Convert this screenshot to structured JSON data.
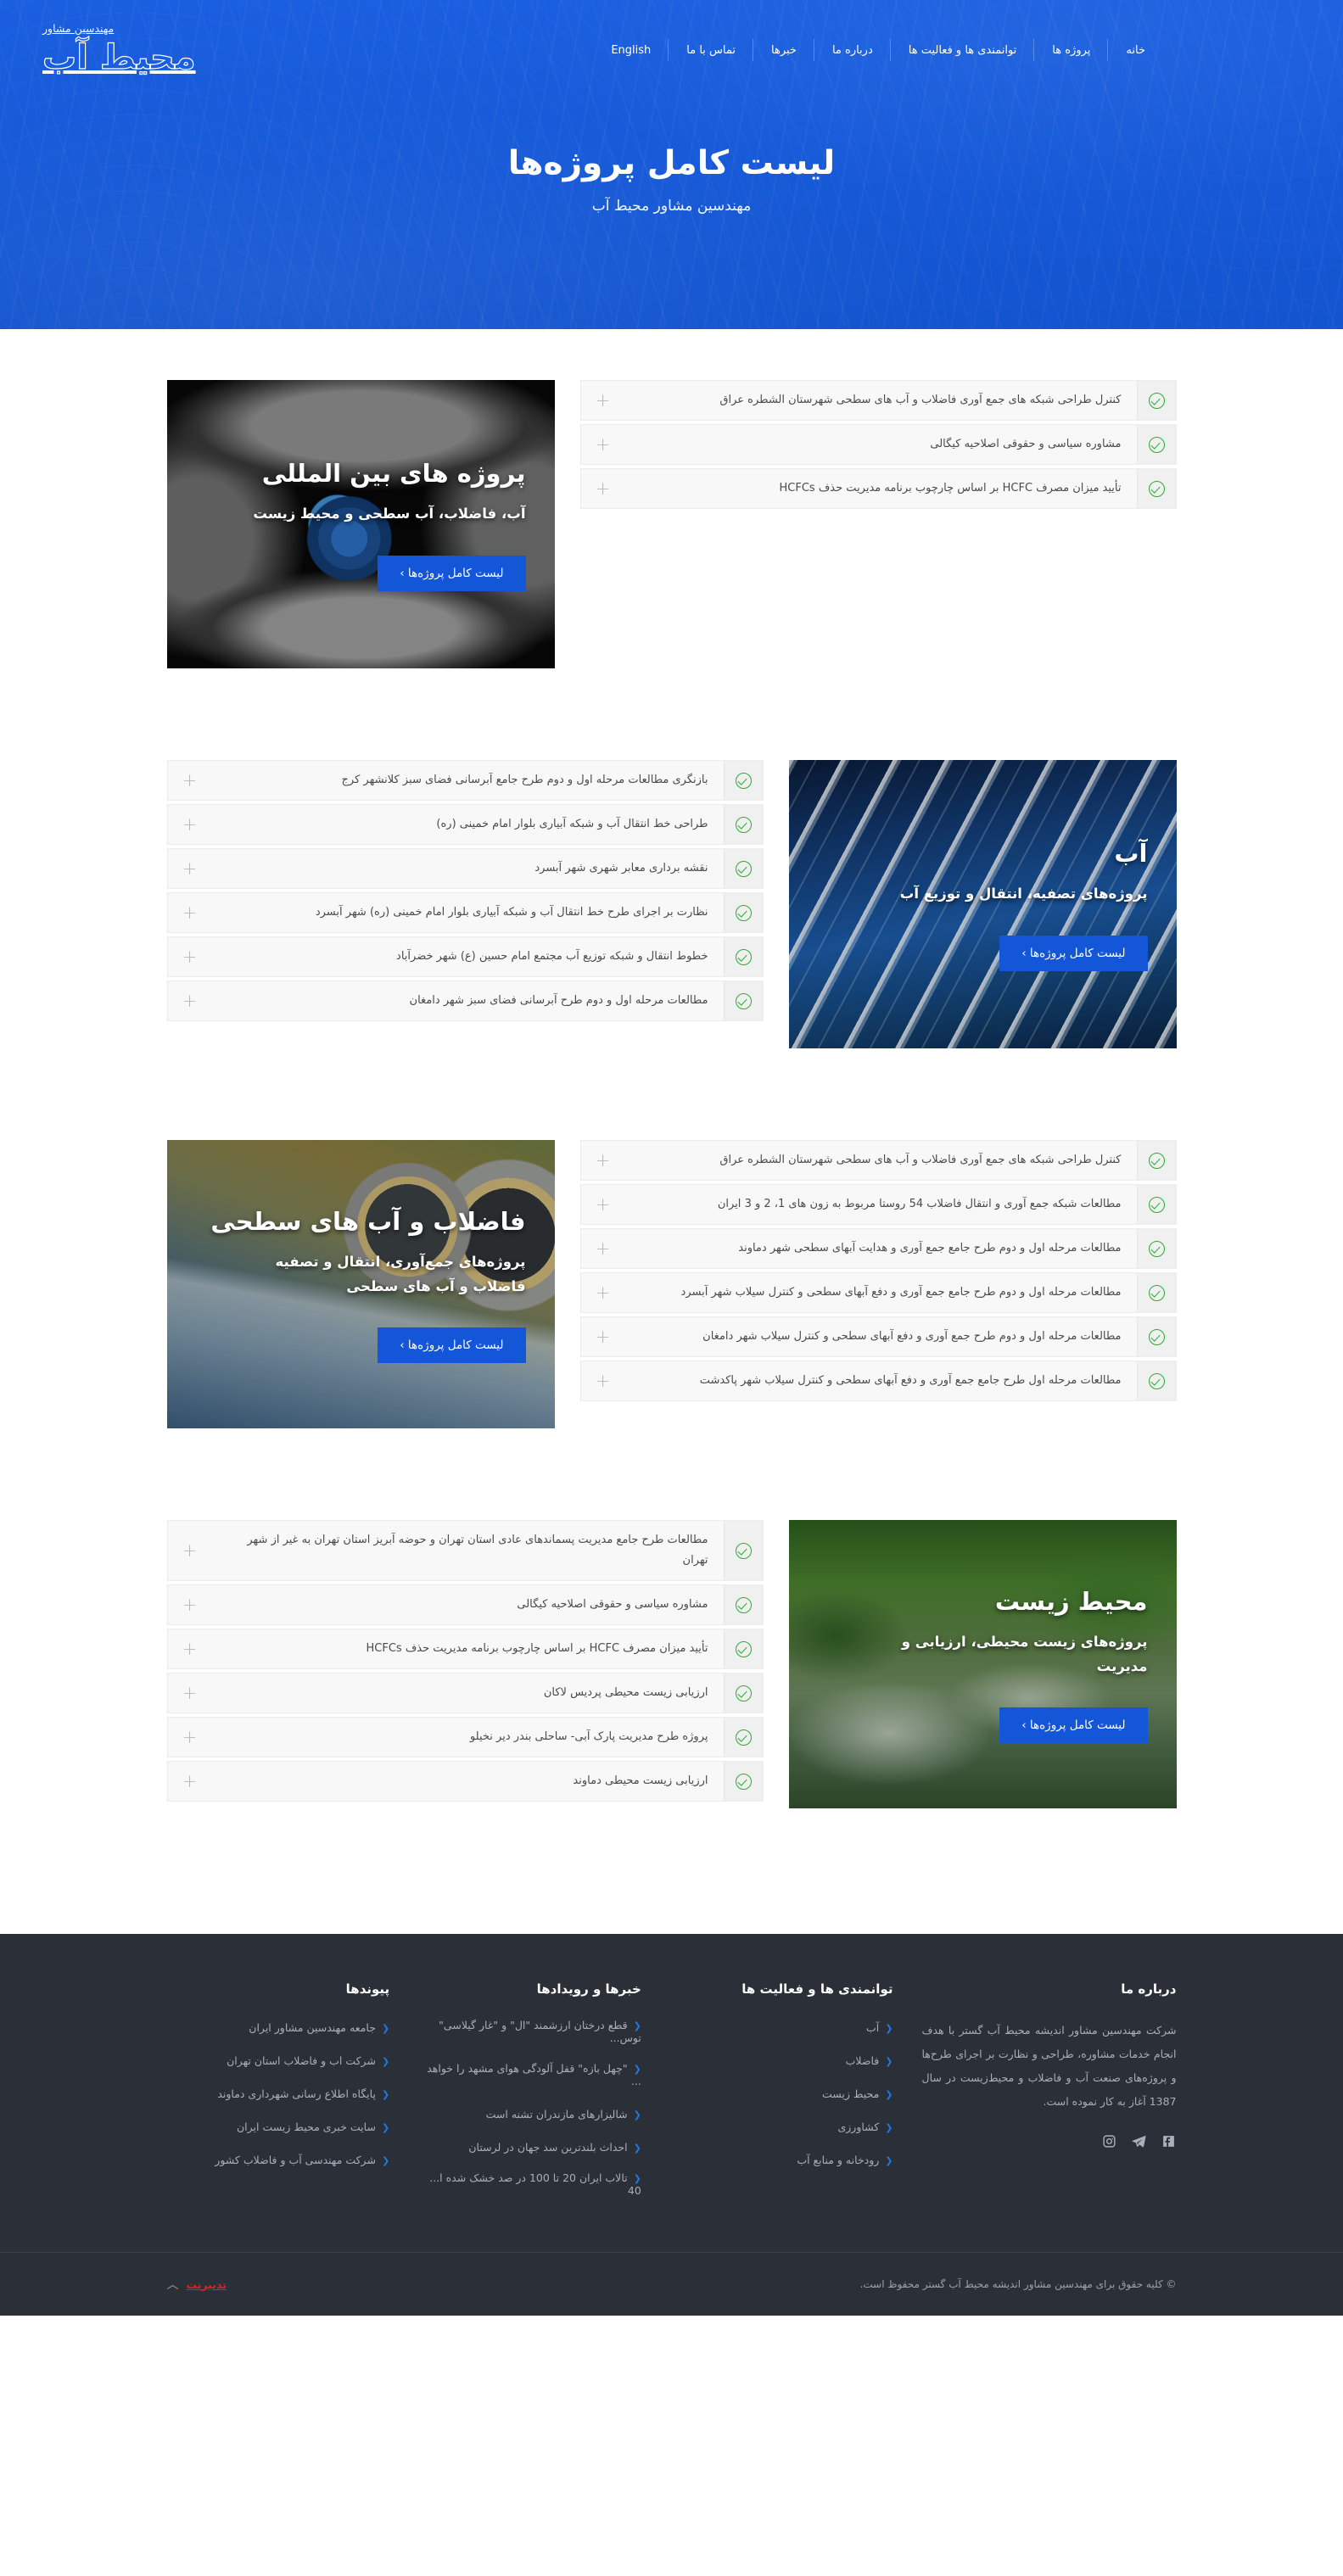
{
  "header": {
    "brand_top": "مهندسین مشاور",
    "brand_logo": "محیط آب",
    "nav": [
      {
        "label": "خانه"
      },
      {
        "label": "پروژه ها"
      },
      {
        "label": "توانمندی ها و فعالیت ها"
      },
      {
        "label": "درباره ما"
      },
      {
        "label": "خبرها"
      },
      {
        "label": "تماس با ما"
      },
      {
        "label": "English"
      }
    ]
  },
  "hero": {
    "title": "لیست کامل پروژه‌ها",
    "subtitle": "مهندسین مشاور محیط آب"
  },
  "sections": [
    {
      "card": {
        "title": "پروژه های بین المللی",
        "desc": "آب، فاضلاب، آب سطحی و محیط زیست",
        "button": "لیست کامل پروژه‌ها ›"
      },
      "items": [
        "کنترل طراحی شبکه های جمع آوری فاضلاب و آب های سطحی شهرستان الشطره عراق",
        "مشاوره سیاسی و حقوقی اصلاحیه کیگالی",
        "تأیید میزان مصرف HCFC بر اساس چارچوب برنامه مدیریت حذف HCFCs"
      ]
    },
    {
      "card": {
        "title": "آب",
        "desc": "پروژه‌های تصفیه، انتقال و توزیع آب",
        "button": "لیست کامل پروژه‌ها ›"
      },
      "items": [
        "بازنگری مطالعات مرحله اول و دوم طرح جامع آبرسانی فضای سبز کلانشهر کرج",
        "طراحی خط انتقال آب و شبکه آبیاری بلوار امام خمینی (ره)",
        "نقشه برداری معابر شهری شهر آبسرد",
        "نظارت بر اجرای طرح خط انتقال آب و شبکه آبیاری بلوار امام خمینی (ره) شهر آبسرد",
        "خطوط انتقال و شبکه توزیع آب مجتمع امام حسین (ع) شهر خضرآباد",
        "مطالعات مرحله اول و دوم طرح آبرسانی فضای سبز شهر دامغان"
      ]
    },
    {
      "card": {
        "title": "فاضلاب و آب های سطحی",
        "desc": "پروژه‌های جمع‌آوری، انتقال و تصفیه فاضلاب و آب های سطحی",
        "button": "لیست کامل پروژه‌ها ›"
      },
      "items": [
        "کنترل طراحی شبکه های جمع آوری فاضلاب و آب های سطحی شهرستان الشطره عراق",
        "مطالعات شبکه جمع آوری و انتقال فاضلاب 54 روستا مربوط به زون های 1، 2 و 3 ایران",
        "مطالعات مرحله اول و دوم طرح جامع جمع آوری و هدایت آبهای سطحی شهر دماوند",
        "مطالعات مرحله اول و دوم طرح جامع جمع آوری و دفع آبهای سطحی و کنترل سیلاب شهر آبسرد",
        "مطالعات مرحله اول و دوم طرح جمع آوری و دفع آبهای سطحی و کنترل سیلاب شهر دامغان",
        "مطالعات مرحله اول طرح جامع جمع آوری و دفع آبهای سطحی و کنترل سیلاب شهر پاکدشت"
      ]
    },
    {
      "card": {
        "title": "محیط زیست",
        "desc": "پروژه‌های زیست محیطی، ارزیابی و مدیریت",
        "button": "لیست کامل پروژه‌ها ›"
      },
      "items": [
        "مطالعات طرح جامع مدیریت پسماندهای عادی استان تهران و حوضه آبریز استان تهران به غیر از شهر تهران",
        "مشاوره سیاسی و حقوقی اصلاحیه کیگالی",
        "تأیید میزان مصرف HCFC بر اساس چارچوب برنامه مدیریت حذف HCFCs",
        "ارزیابی زیست محیطی پردیس لاکان",
        "پروژه طرح مدیریت پارک آبی- ساحلی بندر دیر نخیلو",
        "ارزیابی زیست محیطی دماوند"
      ]
    }
  ],
  "footer": {
    "about": {
      "heading": "درباره ما",
      "text": "شرکت مهندسین مشاور اندیشه محیط آب گستر با هدف انجام خدمات مشاوره، طراحی و نظارت بر اجرای طرح‌ها و پروژه‌های صنعت آب و فاضلاب و محیط‌زیست در سال 1387 آغاز به کار نموده است.",
      "socials": [
        "facebook-icon",
        "telegram-icon",
        "instagram-icon"
      ]
    },
    "capabilities": {
      "heading": "توانمندی ها و فعالیت ها",
      "links": [
        "آب",
        "فاضلاب",
        "محیط زیست",
        "کشاورزی",
        "رودخانه و منابع آب"
      ]
    },
    "news": {
      "heading": "خبرها و رویدادها",
      "links": [
        "قطع درختان ارزشمند \"ال\" و \"غار گیلاسی\" توس...",
        "\"چهل بازه\" قفل آلودگی هوای مشهد را خواهد ...",
        "شالیزارهای مازندران تشنه است",
        "احداث بلندترین سد جهان در لرستان",
        "تالاب ایران 20 تا 100 در صد خشک شده ا... 40"
      ]
    },
    "links": {
      "heading": "پیوندها",
      "links": [
        "جامعه مهندسین مشاور ایران",
        "شرکت اب و فاضلاب استان تهران",
        "پایگاه اطلاع رسانی شهرداری دماوند",
        "سایت خبری محیط زیست ایران",
        "شرکت مهندسی آب و فاضلاب کشور"
      ]
    },
    "bottom": {
      "copyright": "© کلیه حقوق برای مهندسین مشاور اندیشه محیط آب گستر محفوظ است.",
      "credit": "تدبیرنت"
    }
  },
  "colors": {
    "brand_blue": "#1458d6",
    "button_blue": "#1356d8",
    "check_green": "#27ae33",
    "footer_bg": "#2b2f37",
    "accent_red": "#e02020"
  }
}
